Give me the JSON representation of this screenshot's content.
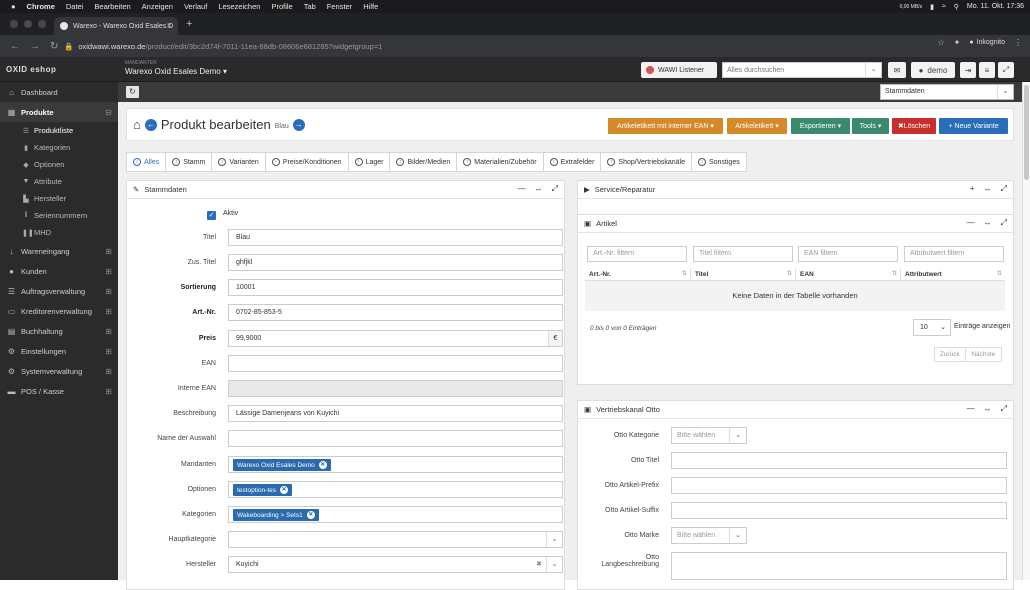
{
  "macbar": {
    "apple": "",
    "items": [
      "Chrome",
      "Datei",
      "Bearbeiten",
      "Anzeigen",
      "Verlauf",
      "Lesezeichen",
      "Profile",
      "Tab",
      "Fenster",
      "Hilfe"
    ],
    "netspeed": "0,00 MB/s",
    "datetime": "Mo. 11. Okt.  17:36"
  },
  "browser": {
    "tab_title": "Warexo - Warexo Oxid Esales D",
    "url_host": "oxidwawi.warexo.de",
    "url_path": "/product/edit/3bc2d74f-7011-11ea-88db-08606e681285?widgetgroup=1",
    "incognito": "Inkognito"
  },
  "app": {
    "logo": "OXID eshop",
    "mandant_caption": "MANDANTEN",
    "mandant_name": "Warexo Oxid Esales Demo",
    "wawi_listener": "WAWI Listener",
    "search_placeholder": "Alles durchsuchen",
    "user": "demo"
  },
  "sidebar": {
    "items": [
      {
        "label": "Dashboard",
        "icon": "dashboard-icon"
      },
      {
        "label": "Produkte",
        "icon": "products-icon"
      },
      {
        "label": "Wareneingang",
        "icon": "arrow-down-icon"
      },
      {
        "label": "Kunden",
        "icon": "user-icon"
      },
      {
        "label": "Auftragsverwaltung",
        "icon": "list-icon"
      },
      {
        "label": "Kreditorenverwaltung",
        "icon": "card-icon"
      },
      {
        "label": "Buchhaltung",
        "icon": "book-icon"
      },
      {
        "label": "Einstellungen",
        "icon": "cog-icon"
      },
      {
        "label": "Systemverwaltung",
        "icon": "cogs-icon"
      },
      {
        "label": "POS / Kasse",
        "icon": "folder-icon"
      }
    ],
    "subitems": [
      {
        "label": "Produktliste",
        "icon": "list-icon"
      },
      {
        "label": "Kategorien",
        "icon": "bookmark-icon"
      },
      {
        "label": "Optionen",
        "icon": "tag-icon"
      },
      {
        "label": "Attribute",
        "icon": "filter-icon"
      },
      {
        "label": "Hersteller",
        "icon": "factory-icon"
      },
      {
        "label": "Seriennummern",
        "icon": "barcode-icon"
      },
      {
        "label": "MHD",
        "icon": "pause-icon"
      }
    ]
  },
  "toolbar": {
    "view_select": "Stammdaten"
  },
  "header": {
    "title": "Produkt bearbeiten",
    "subtitle": "Blau",
    "buttons": [
      {
        "label": "Artikeletikett mit interner EAN ▾",
        "color": "#d58a2a"
      },
      {
        "label": "Artikeletikett ▾",
        "color": "#d58a2a"
      },
      {
        "label": "Exportieren ▾",
        "color": "#3b8a6e"
      },
      {
        "label": "Tools ▾",
        "color": "#3b8a6e"
      },
      {
        "label": "✖Löschen",
        "color": "#c9302c"
      },
      {
        "label": "+ Neue Variante",
        "color": "#2a6ebb"
      }
    ]
  },
  "tabs": [
    "Alles",
    "Stamm",
    "Varianten",
    "Preise/Konditionen",
    "Lager",
    "Bilder/Medien",
    "Materialien/Zubehör",
    "Extrafelder",
    "Shop/Vertriebskanäle",
    "Sonstiges"
  ],
  "stammdaten": {
    "title": "Stammdaten",
    "aktiv_label": "Aktiv",
    "fields": [
      {
        "label": "Titel",
        "value": "Blau",
        "bold": false
      },
      {
        "label": "Zus. Titel",
        "value": "ghfjkl",
        "bold": false
      },
      {
        "label": "Sortierung",
        "value": "10001",
        "bold": true
      },
      {
        "label": "Art.-Nr.",
        "value": "0702-85-853-5",
        "bold": true
      },
      {
        "label": "Preis",
        "value": "99,9000",
        "bold": true,
        "suffix": "€"
      },
      {
        "label": "EAN",
        "value": "",
        "bold": false
      },
      {
        "label": "Interne EAN",
        "value": "",
        "bold": false,
        "disabled": true
      },
      {
        "label": "Beschreibung",
        "value": "Lässige Damenjeans von Kuyichi",
        "bold": false
      },
      {
        "label": "Name der Auswahl",
        "value": "",
        "bold": false
      },
      {
        "label": "Mandanten",
        "tag": "Warexo Oxid Esales Demo",
        "bold": false
      },
      {
        "label": "Optionen",
        "tag": "testoption-tes",
        "bold": false
      },
      {
        "label": "Kategorien",
        "tag": "Wakeboarding > Sets1",
        "bold": false
      },
      {
        "label": "Hauptkategorie",
        "value": "",
        "bold": false,
        "select": true
      },
      {
        "label": "Hersteller",
        "value": "Kuyichi",
        "bold": false,
        "select": true,
        "clear": true
      }
    ]
  },
  "service": {
    "title": "Service/Reparatur"
  },
  "artikel": {
    "title": "Artikel",
    "filters": [
      "Art.-Nr. filtern",
      "Titel filtern",
      "EAN filtern",
      "Attributwert filtern"
    ],
    "columns": [
      "Art.-Nr.",
      "Titel",
      "EAN",
      "Attributwert"
    ],
    "empty": "Keine Daten in der Tabelle vorhanden",
    "info": "0 bis 0 von 0 Einträgen",
    "page_size": "10",
    "page_size_label": "Einträge anzeigen",
    "prev": "Zurück",
    "next": "Nächste"
  },
  "otto": {
    "title": "Vertriebskanal Otto",
    "select_placeholder": "Bitte wählen",
    "kategorie": "Otto Kategorie",
    "titel": "Otto Titel",
    "prefix": "Otto Artikel-Prefix",
    "suffix": "Otto Artikel-Suffix",
    "marke": "Otto Marke",
    "lang1": "Otto",
    "lang2": "Langbeschreibung"
  }
}
